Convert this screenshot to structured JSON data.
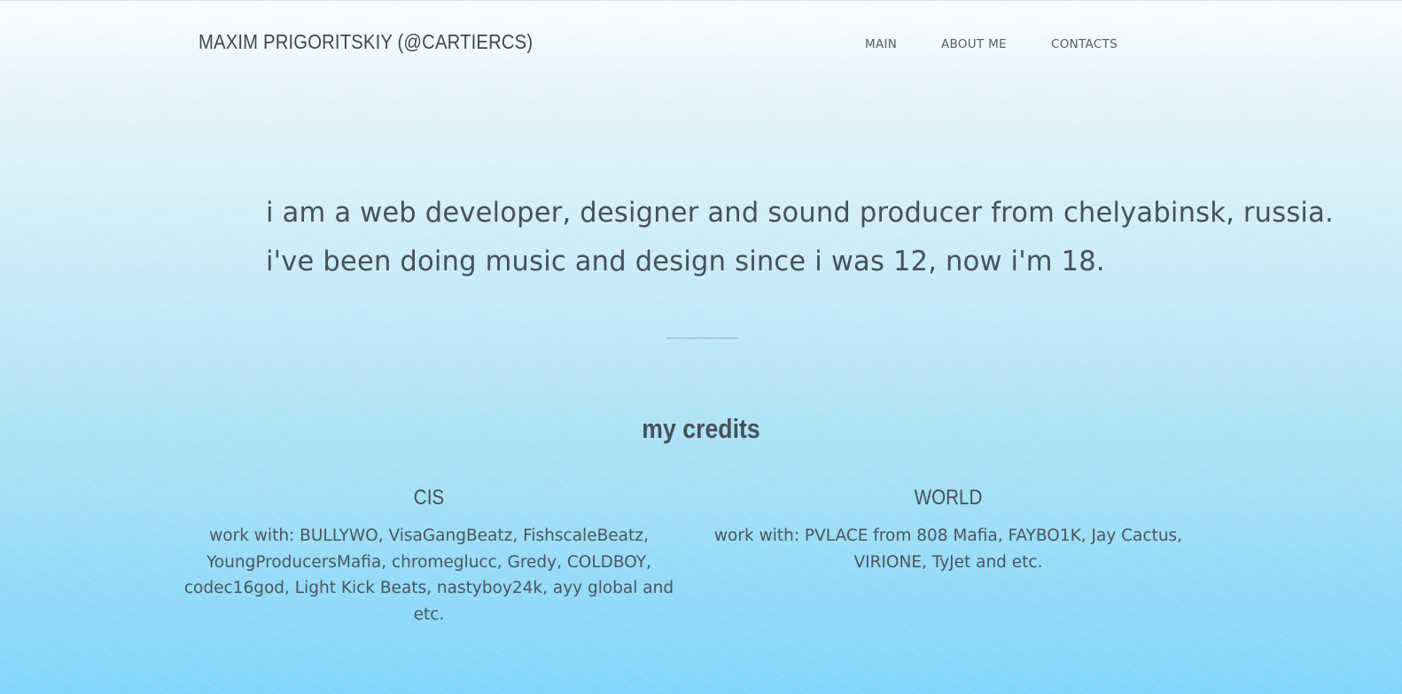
{
  "header": {
    "brand": "MAXIM PRIGORITSKIY (@CARTIERCS)",
    "nav": [
      "MAIN",
      "ABOUT ME",
      "CONTACTS"
    ]
  },
  "intro": {
    "line1": "i am a web developer, designer and sound producer from chelyabinsk, russia.",
    "line2": "i've been doing music and design since i was 12, now i'm 18."
  },
  "credits": {
    "title": "my credits",
    "columns": [
      {
        "heading": "CIS",
        "text": "work with: BULLYWO, VisaGangBeatz, FishscaleBeatz, YoungProducersMafia, chromeglucc, Gredy, COLDBOY, codec16god, Light Kick Beats, nastyboy24k, ayy global and etc."
      },
      {
        "heading": "WORLD",
        "text": "work with: PVLACE from 808 Mafia, FAYBO1K, Jay Cactus, VIRIONE, TyJet and etc."
      }
    ]
  },
  "colors": {
    "text": "#46515b",
    "background_top": "#fafcfd",
    "background_bottom": "#82d6fb"
  }
}
